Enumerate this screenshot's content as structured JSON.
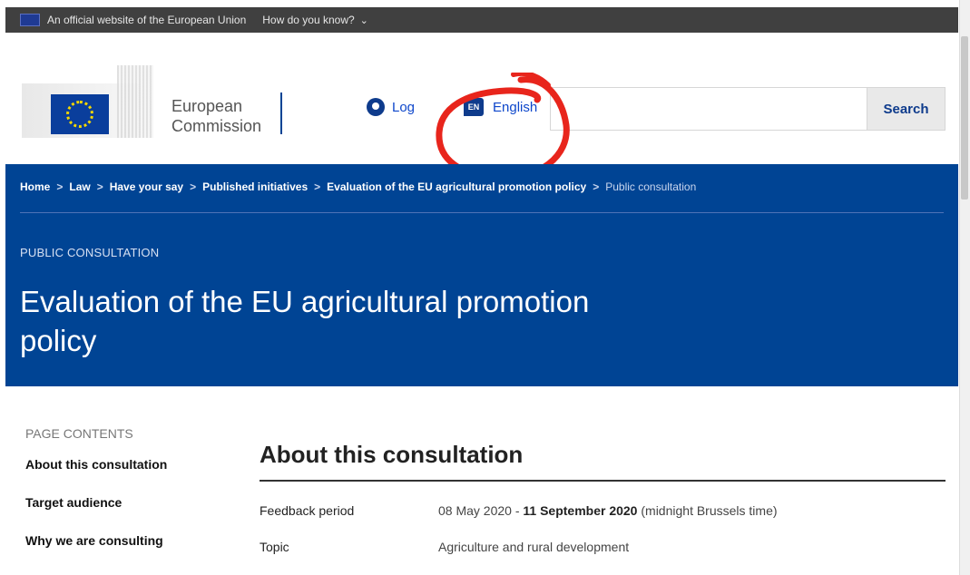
{
  "official_bar": {
    "text": "An official website of the European Union",
    "how_know": "How do you know?"
  },
  "logo": {
    "line1": "European",
    "line2": "Commission"
  },
  "header": {
    "login_label": "Log",
    "language_label": "English",
    "language_code": "EN",
    "search_placeholder": "",
    "search_button": "Search"
  },
  "breadcrumb": [
    "Home",
    "Law",
    "Have your say",
    "Published initiatives",
    "Evaluation of the EU agricultural promotion policy",
    "Public consultation"
  ],
  "banner": {
    "overline": "PUBLIC CONSULTATION",
    "title": "Evaluation of the EU agricultural promotion policy"
  },
  "sidebar": {
    "heading": "PAGE CONTENTS",
    "items": [
      "About this consultation",
      "Target audience",
      "Why we are consulting"
    ]
  },
  "main": {
    "section_title": "About this consultation",
    "rows": [
      {
        "label": "Feedback period",
        "value_start": "08 May 2020 - ",
        "value_end": "11 September 2020",
        "value_note": "(midnight Brussels time)"
      },
      {
        "label": "Topic",
        "value": "Agriculture and rural development"
      }
    ]
  },
  "colors": {
    "brand_blue": "#004494",
    "link_blue": "#0e47cb",
    "annotation_red": "#e8251c"
  }
}
